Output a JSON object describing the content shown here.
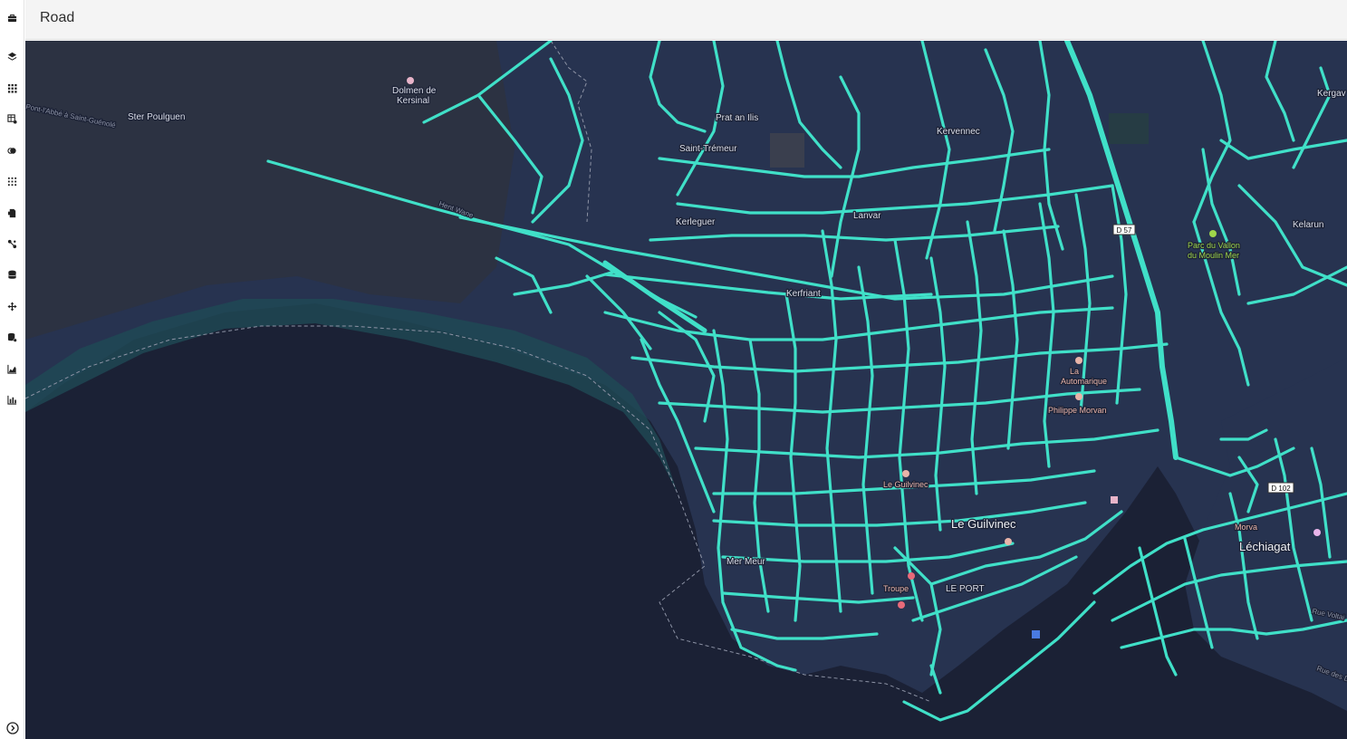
{
  "app": {
    "title": "Road"
  },
  "sidebar": {
    "items": [
      {
        "icon": "briefcase-icon"
      },
      {
        "icon": "layers-icon"
      },
      {
        "icon": "grid-dots-icon"
      },
      {
        "icon": "table-settings-icon"
      },
      {
        "icon": "circles-icon"
      },
      {
        "icon": "grid-small-icon"
      },
      {
        "icon": "file-icon"
      },
      {
        "icon": "nodes-icon"
      },
      {
        "icon": "database-icon"
      },
      {
        "icon": "move-icon"
      },
      {
        "icon": "database-settings-icon"
      },
      {
        "icon": "area-chart-icon"
      },
      {
        "icon": "bar-chart-icon"
      }
    ],
    "footer_icon": "chevron-right-circle-icon"
  },
  "map": {
    "style": "dark",
    "water_color": "#1b2135",
    "land_color": "#2a3654",
    "road_color": "#40e0c8",
    "labels": {
      "ster_poulguen": "Ster Poulguen",
      "dolmen_1": "Dolmen de",
      "dolmen_2": "Kersinal",
      "prat_an_ilis": "Prat an Ilis",
      "saint_tremeur": "Saint-Trémeur",
      "kervennec": "Kervennec",
      "kergav": "Kergav",
      "kerleguer": "Kerleguer",
      "lanvar": "Lanvar",
      "kelarun": "Kelarun",
      "kerfriant": "Kerfriant",
      "le_guilvinec": "Le Guilvinec",
      "mer_meur": "Mer Meur",
      "le_port": "LE PORT",
      "lechiagat": "Léchiagat",
      "philippe_morvan": "Philippe Morvan",
      "auto_1": "La",
      "auto_2": "Automarique",
      "park_1": "Parc du Vallon",
      "park_2": "du Moulin Mer",
      "road_abbe": "Pont-l'Abbé à Saint-Guénolé",
      "road_hent": "Hent Wane",
      "road_voltaire": "Rue Voltai",
      "road_des": "Rue des D",
      "poi_guilvinec": "Le Guilvinec",
      "poi_troupe": "Troupe",
      "poi_morvan": "Morva"
    },
    "shields": [
      "D 57",
      "D 102"
    ]
  }
}
